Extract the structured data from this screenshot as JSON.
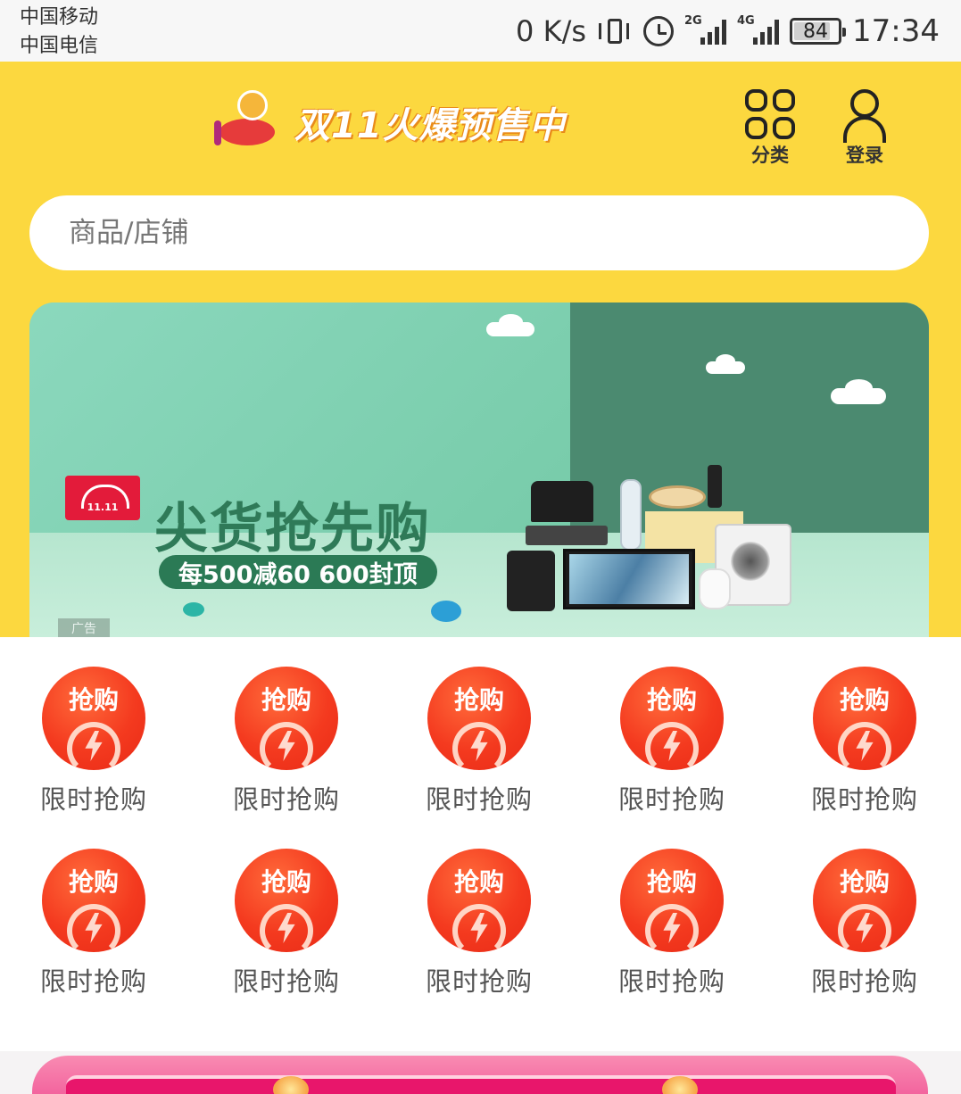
{
  "status_bar": {
    "carrier_1": "中国移动",
    "carrier_2": "中国电信",
    "net_speed": "0 K/s",
    "signal_1_type": "2G",
    "signal_2_type": "4G",
    "battery": "84",
    "battery_level": 0.84,
    "time": "17:34"
  },
  "header": {
    "brand_title": "双11火爆预售中",
    "category_label": "分类",
    "login_label": "登录",
    "background_color": "#fcd83f"
  },
  "search": {
    "placeholder": "商品/店铺"
  },
  "banner": {
    "badge": "11.11",
    "title": "尖货抢先购",
    "subtitle": "每500减60 600封顶",
    "ad_tag": "广告"
  },
  "quick_entries": [
    {
      "badge": "抢购",
      "label": "限时抢购"
    },
    {
      "badge": "抢购",
      "label": "限时抢购"
    },
    {
      "badge": "抢购",
      "label": "限时抢购"
    },
    {
      "badge": "抢购",
      "label": "限时抢购"
    },
    {
      "badge": "抢购",
      "label": "限时抢购"
    },
    {
      "badge": "抢购",
      "label": "限时抢购"
    },
    {
      "badge": "抢购",
      "label": "限时抢购"
    },
    {
      "badge": "抢购",
      "label": "限时抢购"
    },
    {
      "badge": "抢购",
      "label": "限时抢购"
    },
    {
      "badge": "抢购",
      "label": "限时抢购"
    }
  ]
}
